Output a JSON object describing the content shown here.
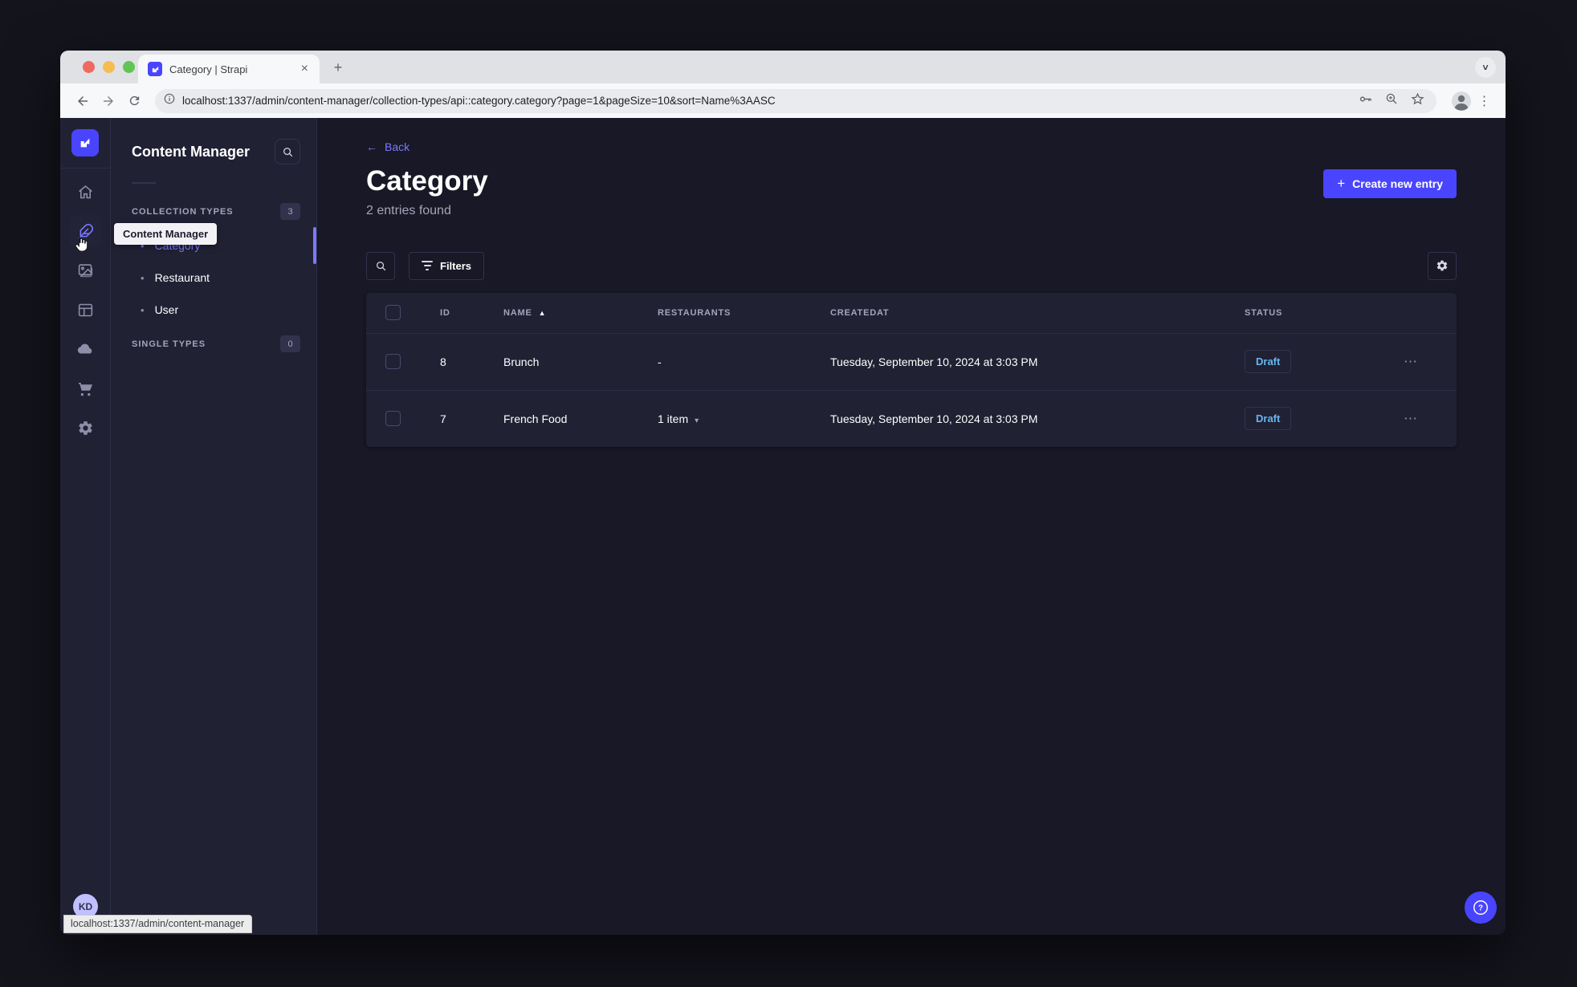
{
  "browser": {
    "tab_title": "Category | Strapi",
    "url": "localhost:1337/admin/content-manager/collection-types/api::category.category?page=1&pageSize=10&sort=Name%3AASC",
    "status_tooltip": "localhost:1337/admin/content-manager"
  },
  "glyphs": {
    "close": "×",
    "new_tab": "+",
    "chevron_down": "˅",
    "menu_dots": "⋮",
    "more_h": "⋯",
    "sort_asc": "▲",
    "caret_down": "▾",
    "bullet": "•",
    "back_arrow": "←",
    "plus": "+"
  },
  "navbar": {
    "tooltip": "Content Manager",
    "user_initials": "KD"
  },
  "subnav": {
    "title": "Content Manager",
    "collection_types": {
      "label": "COLLECTION TYPES",
      "count": "3",
      "items": [
        {
          "label": "Category"
        },
        {
          "label": "Restaurant"
        },
        {
          "label": "User"
        }
      ]
    },
    "single_types": {
      "label": "SINGLE TYPES",
      "count": "0"
    }
  },
  "main": {
    "back_label": "Back",
    "title": "Category",
    "subtitle": "2 entries found",
    "create_button": "Create new entry",
    "filters_button": "Filters",
    "table": {
      "headers": {
        "id": "ID",
        "name": "NAME",
        "restaurants": "RESTAURANTS",
        "createdat": "CREATEDAT",
        "status": "STATUS"
      },
      "rows": [
        {
          "id": "8",
          "name": "Brunch",
          "restaurants": "-",
          "createdat": "Tuesday, September 10, 2024 at 3:03 PM",
          "status": "Draft"
        },
        {
          "id": "7",
          "name": "French Food",
          "restaurants": "1 item",
          "createdat": "Tuesday, September 10, 2024 at 3:03 PM",
          "status": "Draft"
        }
      ]
    }
  },
  "colors": {
    "accent": "#4945ff",
    "link": "#7b79ff",
    "draft_text": "#66b7f1",
    "app_bg": "#181826",
    "panel_bg": "#212134",
    "border": "#32324d",
    "muted_text": "#a5a5ba"
  }
}
